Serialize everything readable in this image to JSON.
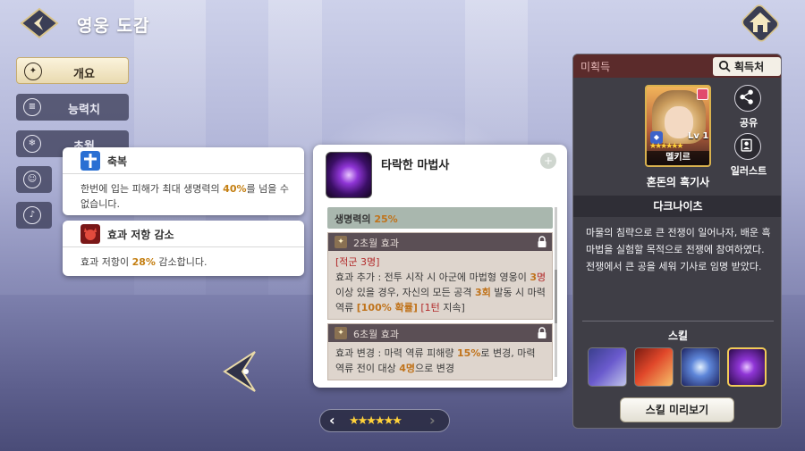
{
  "header": {
    "title": "영웅 도감"
  },
  "tabs": [
    {
      "label": "개요",
      "icon": "target-icon",
      "active": true
    },
    {
      "label": "능력치",
      "icon": "stats-icon",
      "active": false
    },
    {
      "label": "초월",
      "icon": "snowflake-icon",
      "active": false
    }
  ],
  "tooltips": [
    {
      "title": "축복",
      "icon": "cross-icon",
      "body": [
        "한번에 입는 피해가 최대 생명력의 ",
        "40%",
        "를 넘을 수 없습니다."
      ]
    },
    {
      "title": "효과 저항 감소",
      "icon": "demon-icon",
      "body": [
        "효과 저항이 ",
        "28%",
        " 감소합니다."
      ]
    }
  ],
  "skill_panel": {
    "title": "타락한 마법사",
    "stat_line": [
      "생명력의 ",
      "25%"
    ],
    "sections": [
      {
        "head": "2초월 효과",
        "tag": "[적군 3명]",
        "body": [
          "효과 추가 : 전투 시작 시 아군에 마법형 영웅이 ",
          "3",
          "명",
          " 이상 있을 경우, 자신의 모든 공격 ",
          "3회",
          " 발동 시 마력 역류 ",
          "[100% 확률]",
          " ",
          "[1턴",
          " 지속]"
        ]
      },
      {
        "head": "6초월 효과",
        "body": [
          "효과 변경 : 마력 역류 피해량 ",
          "15%",
          "로 변경, 마력 역류 전이 대상 ",
          "4명",
          "으로 변경"
        ]
      }
    ]
  },
  "star_bar": {
    "stars": "★★★★★★"
  },
  "hero": {
    "status": "미획득",
    "obtain_label": "획득처",
    "level": "Lv 1",
    "name": "멜키르",
    "stars": "★★★★★★",
    "class": "혼돈의 흑기사",
    "share_label": "공유",
    "illust_label": "일러스트",
    "title": "다크나이츠",
    "description": "마물의 침략으로 큰 전쟁이 일어나자, 배운 흑마법을 실험할 목적으로 전쟁에 참여하였다. 전쟁에서 큰 공을 세워 기사로 임명 받았다.",
    "skill_label": "스킬",
    "preview_label": "스킬 미리보기"
  },
  "colors": {
    "accent_gold": "#d9b24e",
    "highlight_orange": "#c47f12",
    "status_red": "#5b2b2b"
  }
}
